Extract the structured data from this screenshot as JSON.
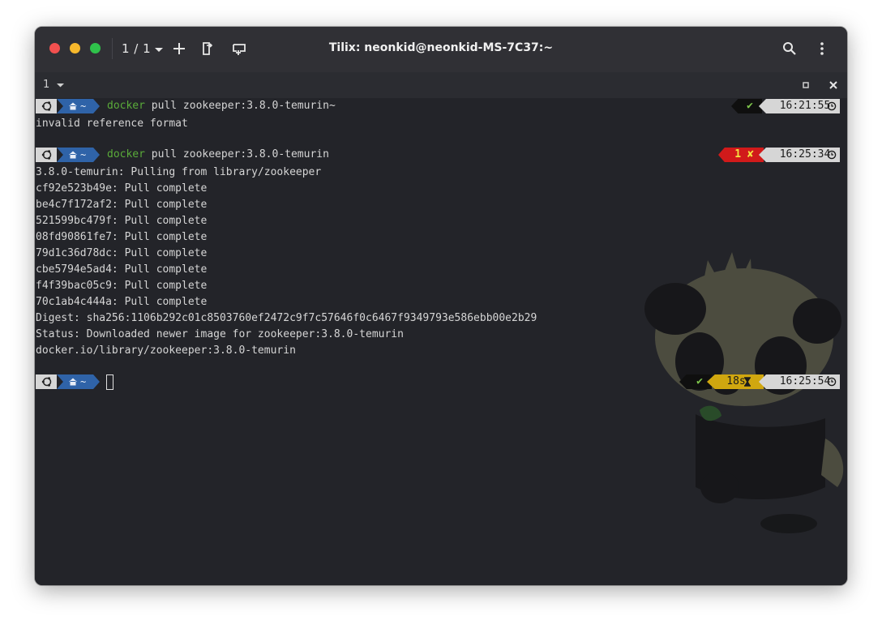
{
  "window": {
    "title": "Tilix: neonkid@neonkid-MS-7C37:~",
    "session_count": "1 / 1",
    "tab_label": "1",
    "icons": [
      "dropdown-icon",
      "add-terminal-icon",
      "detach-icon",
      "new-window-icon",
      "search-icon",
      "kebab-menu-icon",
      "maximize-icon",
      "close-icon"
    ]
  },
  "prompt": {
    "home_label": "~"
  },
  "blocks": [
    {
      "command_program": "docker",
      "command_args": " pull zookeeper:3.8.0-temurin~",
      "status": "✔",
      "time": "16:21:55",
      "output": [
        "invalid reference format"
      ]
    },
    {
      "command_program": "docker",
      "command_args": " pull zookeeper:3.8.0-temurin",
      "status_code": "1",
      "status": "✘",
      "time": "16:25:34",
      "output": [
        "3.8.0-temurin: Pulling from library/zookeeper",
        "cf92e523b49e: Pull complete",
        "be4c7f172af2: Pull complete",
        "521599bc479f: Pull complete",
        "08fd90861fe7: Pull complete",
        "79d1c36d78dc: Pull complete",
        "cbe5794e5ad4: Pull complete",
        "f4f39bac05c9: Pull complete",
        "70c1ab4c444a: Pull complete",
        "Digest: sha256:1106b292c01c8503760ef2472c9f7c57646f0c6467f9349793e586ebb00e2b29",
        "Status: Downloaded newer image for zookeeper:3.8.0-temurin",
        "docker.io/library/zookeeper:3.8.0-temurin"
      ]
    },
    {
      "status": "✔",
      "duration": "18s",
      "time": "16:25:54"
    }
  ],
  "colors": {
    "background": "#232429",
    "titlebar": "#303035",
    "home_segment": "#2f63a8",
    "command_green": "#5aab3a",
    "error_red": "#d11a1a",
    "duration_yellow": "#d0a70f"
  }
}
